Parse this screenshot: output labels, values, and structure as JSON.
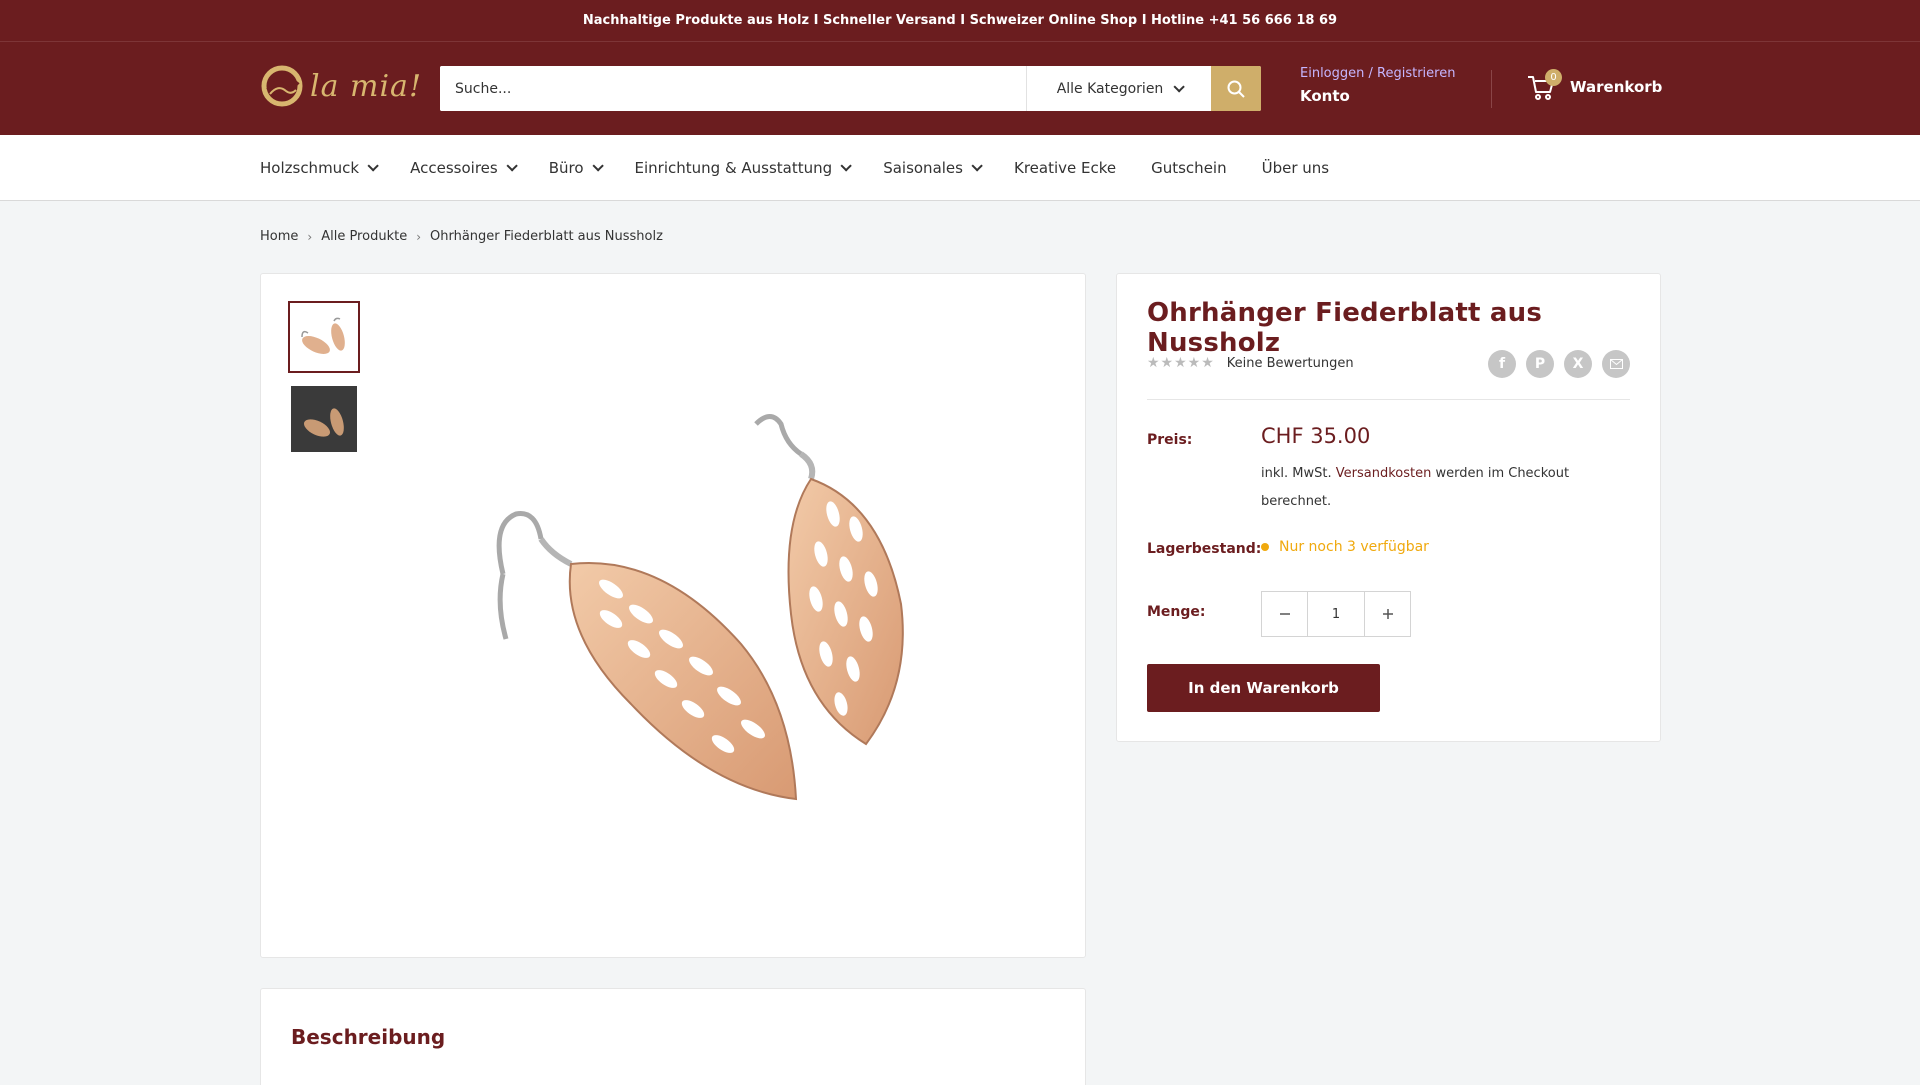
{
  "announcement": "Nachhaltige Produkte aus Holz I Schneller Versand I Schweizer Online Shop I Hotline +41 56 666 18 69",
  "logo": {
    "text": "la mia!"
  },
  "search": {
    "placeholder": "Suche...",
    "category": "Alle Kategorien"
  },
  "account": {
    "login": "Einloggen / Registrieren",
    "label": "Konto"
  },
  "cart": {
    "count": "0",
    "label": "Warenkorb"
  },
  "nav": {
    "items": [
      {
        "label": "Holzschmuck"
      },
      {
        "label": "Accessoires"
      },
      {
        "label": "Büro"
      },
      {
        "label": "Einrichtung & Ausstattung"
      },
      {
        "label": "Saisonales"
      },
      {
        "label": "Kreative Ecke"
      },
      {
        "label": "Gutschein"
      },
      {
        "label": "Über uns"
      }
    ]
  },
  "breadcrumb": [
    "Home",
    "Alle Produkte",
    "Ohrhänger Fiederblatt aus Nussholz"
  ],
  "product": {
    "title": "Ohrhänger Fiederblatt aus Nussholz",
    "rating_text": "Keine Bewertungen",
    "price_label": "Preis:",
    "price": "CHF 35.00",
    "tax_prefix": "inkl. MwSt.",
    "tax_link": "Versandkosten",
    "tax_suffix": "werden im Checkout berechnet.",
    "stock_label": "Lagerbestand:",
    "stock_text": "Nur noch 3 verfügbar",
    "qty_label": "Menge:",
    "qty": "1",
    "add_to_cart": "In den Warenkorb"
  },
  "description": {
    "heading": "Beschreibung"
  },
  "colors": {
    "brand": "#6b1d1f",
    "gold": "#cfae6a",
    "stock": "#f0a90e"
  }
}
